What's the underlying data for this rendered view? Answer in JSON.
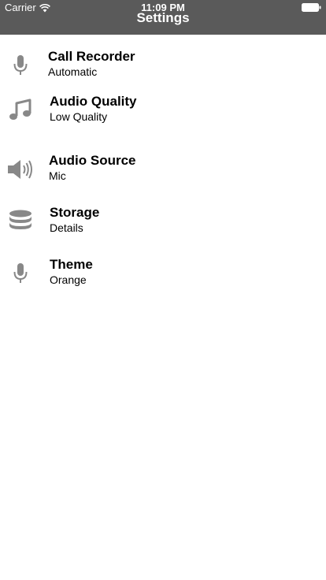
{
  "status_bar": {
    "carrier": "Carrier",
    "time": "11:09 PM",
    "wifi_icon": "wifi-icon",
    "battery_icon": "battery-icon"
  },
  "nav": {
    "title": "Settings",
    "background": "#5a5a5a"
  },
  "settings": [
    {
      "title": "Call Recorder",
      "subtitle": "Automatic",
      "icon": "microphone-icon"
    },
    {
      "title": "Audio Quality",
      "subtitle": "Low Quality",
      "icon": "music-note-icon"
    },
    {
      "title": "Audio Source",
      "subtitle": "Mic",
      "icon": "speaker-icon"
    },
    {
      "title": "Storage",
      "subtitle": "Details",
      "icon": "database-icon"
    },
    {
      "title": "Theme",
      "subtitle": "Orange",
      "icon": "microphone-icon"
    }
  ],
  "icon_color": "#888888"
}
